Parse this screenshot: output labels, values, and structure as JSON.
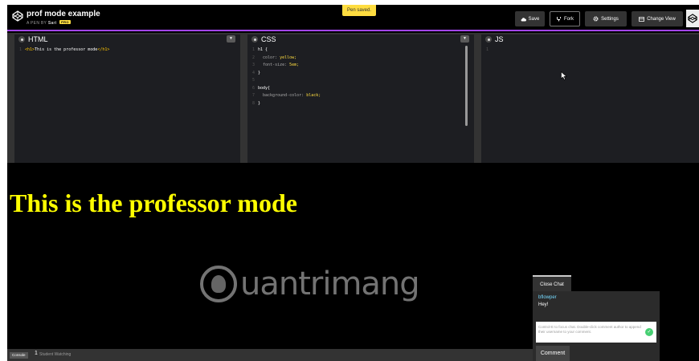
{
  "header": {
    "title": "prof mode example",
    "byline_prefix": "A PEN BY",
    "author": "Sari",
    "pro_badge": "PRO",
    "toast": "Pen saved.",
    "buttons": {
      "save": "Save",
      "fork": "Fork",
      "settings": "Settings",
      "change_view": "Change View"
    }
  },
  "editors": {
    "html": {
      "label": "HTML"
    },
    "css": {
      "label": "CSS"
    },
    "js": {
      "label": "JS"
    }
  },
  "code": {
    "html": [
      [
        {
          "t": "<h1>",
          "c": "k-tag"
        },
        {
          "t": "This is the professor mode",
          "c": "k-txt"
        },
        {
          "t": "</h1>",
          "c": "k-tag"
        }
      ]
    ],
    "css": [
      [
        {
          "t": "h1 {",
          "c": "k-sel"
        }
      ],
      [
        {
          "t": "  color: ",
          "c": "k-prop"
        },
        {
          "t": "yellow;",
          "c": "k-val"
        }
      ],
      [
        {
          "t": "  font-size: ",
          "c": "k-prop"
        },
        {
          "t": "5em;",
          "c": "k-val"
        }
      ],
      [
        {
          "t": "}",
          "c": "k-sel"
        }
      ],
      [
        {
          "t": "",
          "c": "k-sel"
        }
      ],
      [
        {
          "t": "body{",
          "c": "k-sel"
        }
      ],
      [
        {
          "t": "  background-color: ",
          "c": "k-prop"
        },
        {
          "t": "black;",
          "c": "k-val"
        }
      ],
      [
        {
          "t": "}",
          "c": "k-sel"
        }
      ]
    ],
    "js": [
      [
        {
          "t": "",
          "c": "k-txt"
        }
      ]
    ]
  },
  "preview": {
    "heading": "This is the professor mode",
    "watermark": "uantrimang"
  },
  "chat": {
    "close_label": "Close Chat",
    "username": "bflowper",
    "message": "Hey!",
    "hint": "Control-E to focus chat. Double-click comment author to append their username to your comment.",
    "comment_button": "Comment"
  },
  "footer": {
    "console_label": "Console",
    "watch_count": "1",
    "watch_label": "Student Watching"
  },
  "colors": {
    "accent_bar": "#a245f2",
    "toast_bg": "#ffdd40",
    "preview_text": "#ffff00",
    "chat_username": "#76daff",
    "send_button": "#47cf73"
  }
}
